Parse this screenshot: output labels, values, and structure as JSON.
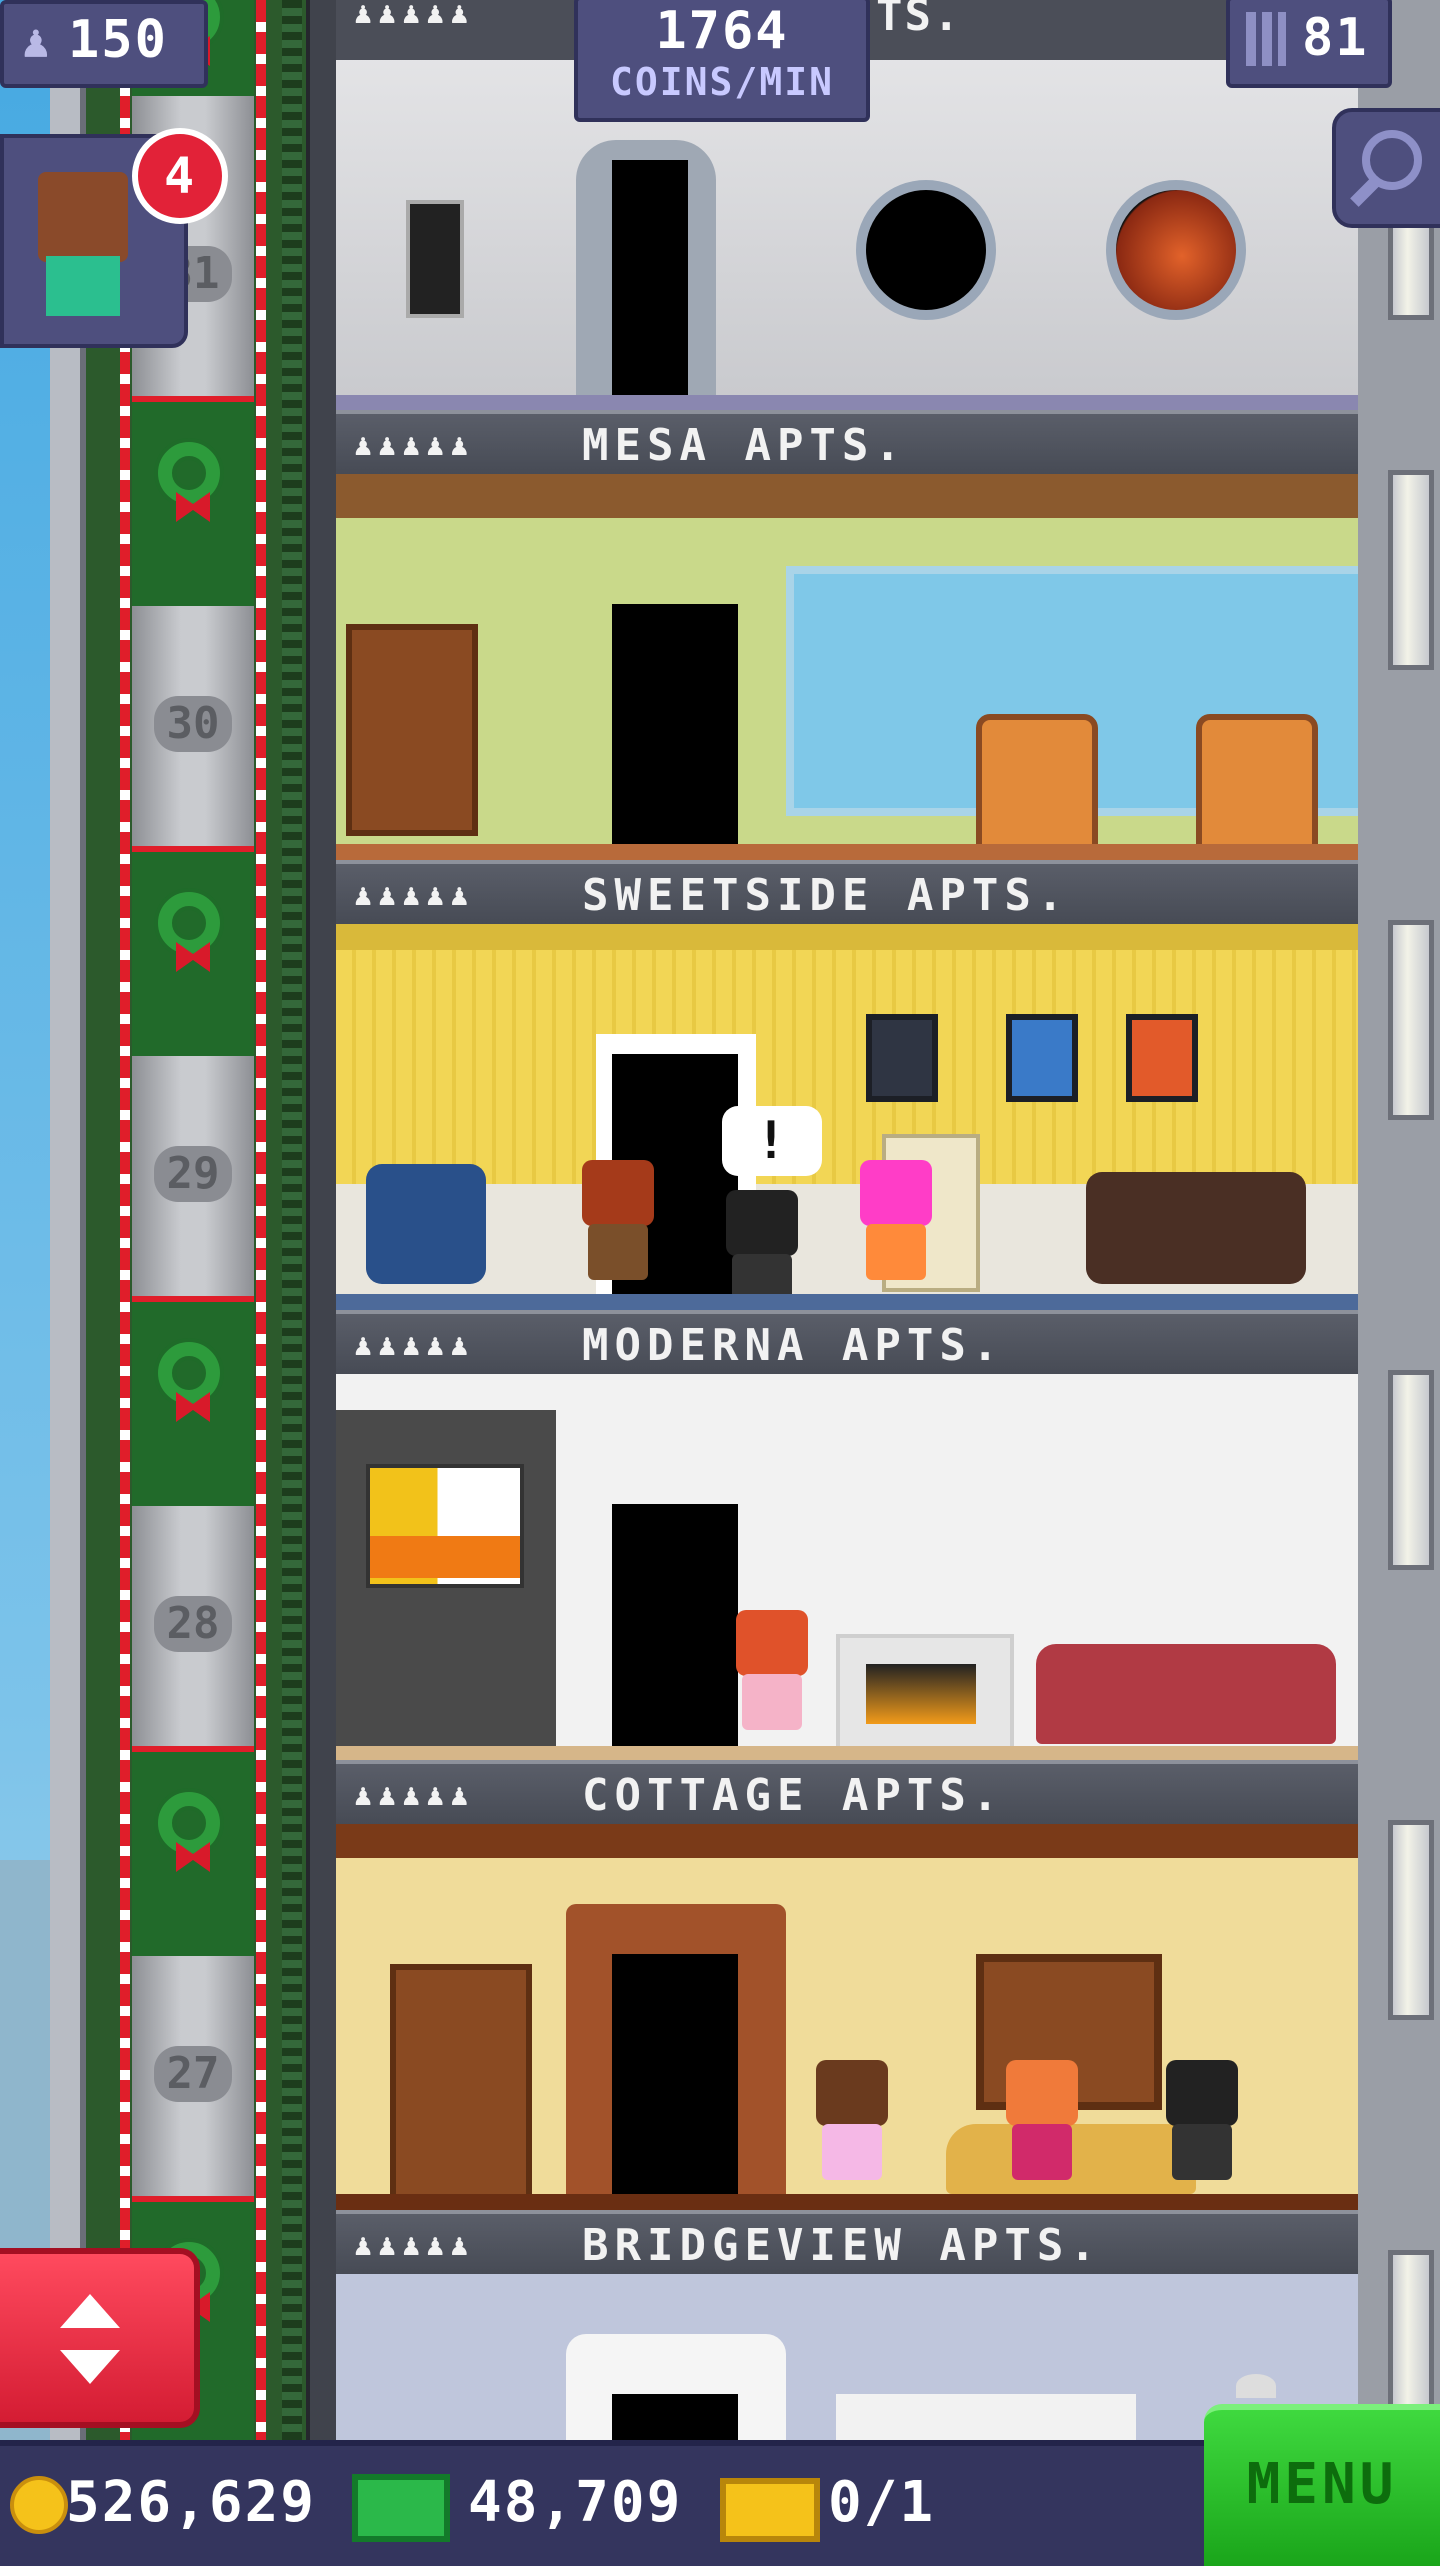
{
  "hud": {
    "population": "150",
    "coins_rate_value": "1764",
    "coins_rate_unit": "COINS/MIN",
    "floors_count": "81",
    "top_floor_sign_fragment": "TS.",
    "notification_count": "4"
  },
  "bottom_bar": {
    "coins": "526,629",
    "bux": "48,709",
    "vip": "0/1",
    "menu_label": "MENU"
  },
  "floors": [
    {
      "sign": "MESA APTS.",
      "people": "♟♟♟♟♟"
    },
    {
      "sign": "SWEETSIDE APTS.",
      "people": "♟♟♟♟♟"
    },
    {
      "sign": "MODERNA APTS.",
      "people": "♟♟♟♟♟"
    },
    {
      "sign": "COTTAGE APTS.",
      "people": "♟♟♟♟♟"
    },
    {
      "sign": "BRIDGEVIEW APTS.",
      "people": "♟♟♟♟♟"
    }
  ],
  "elevator_floor_numbers": [
    "31",
    "30",
    "29",
    "28",
    "27"
  ],
  "speech_bubble": "!",
  "colors": {
    "hud_bg": "#4e4f7e",
    "menu_green": "#2bc12b",
    "elevator_red": "#e01e2a",
    "sign_bg": "#4f535e"
  }
}
